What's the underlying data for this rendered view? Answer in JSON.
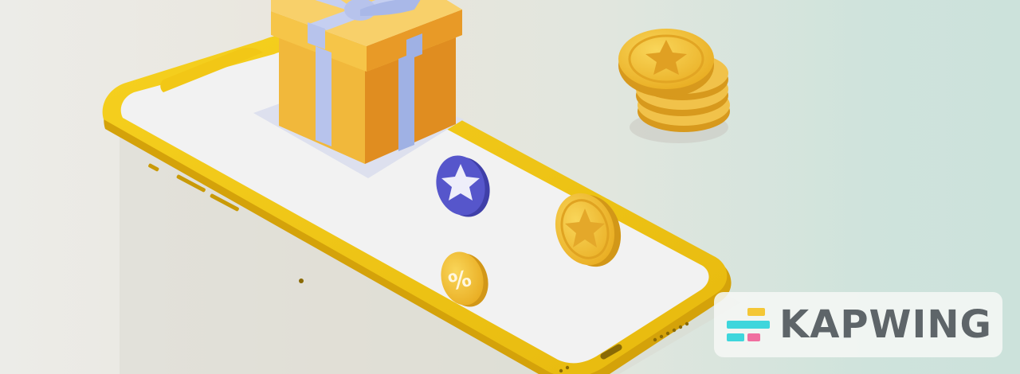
{
  "scene": {
    "colors": {
      "phone_frame": "#f2c716",
      "phone_frame_dark": "#d9a90c",
      "screen": "#f1f1f1",
      "gift_box": "#f1b83b",
      "gift_ribbon": "#aebde8",
      "coin_gold": "#f0bf3c",
      "coin_star_blue": "#5454c8"
    },
    "icons": [
      "gift-box-icon",
      "star-coin-icon",
      "percent-coin-icon",
      "coin-stack-icon"
    ],
    "percent_symbol": "%"
  },
  "logo": {
    "text": "KAPWING",
    "colors": {
      "text": "#5e6569",
      "bar_yellow": "#f4c736",
      "bar_cyan": "#3ed6dc",
      "bar_pink": "#f06fa0"
    }
  }
}
